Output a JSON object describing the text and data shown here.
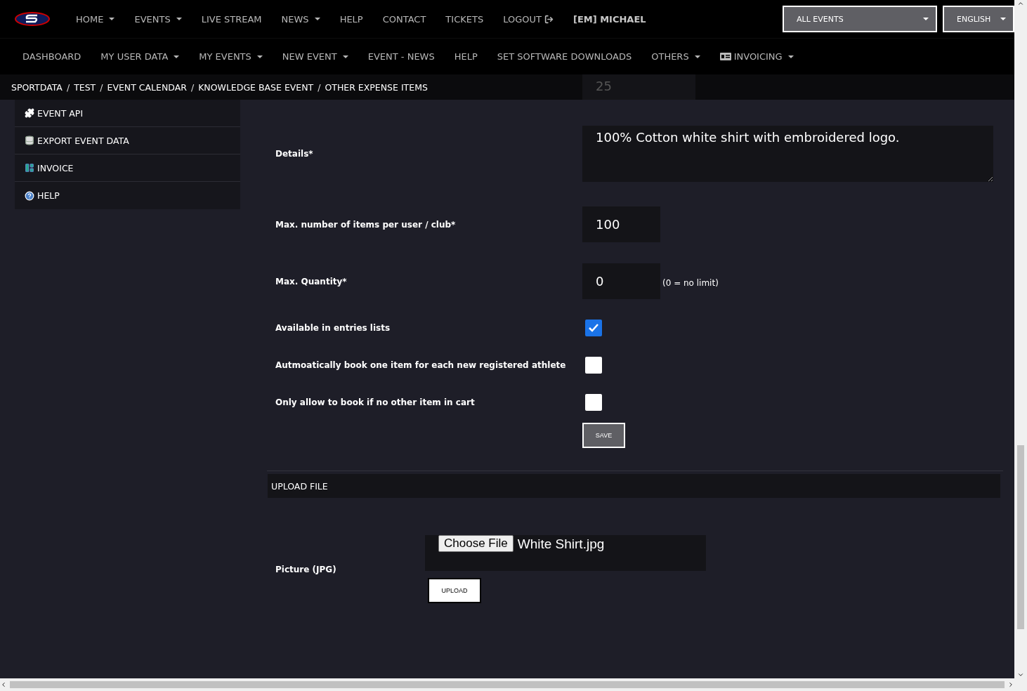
{
  "top_nav": {
    "items": [
      {
        "label": "HOME",
        "dropdown": true,
        "kind": "link"
      },
      {
        "label": "EVENTS",
        "dropdown": true,
        "kind": "link"
      },
      {
        "label": "LIVE STREAM",
        "dropdown": false,
        "kind": "link"
      },
      {
        "label": "NEWS",
        "dropdown": true,
        "kind": "link"
      },
      {
        "label": "HELP",
        "dropdown": false,
        "kind": "link"
      },
      {
        "label": "CONTACT",
        "dropdown": false,
        "kind": "link"
      },
      {
        "label": "TICKETS",
        "dropdown": false,
        "kind": "link"
      },
      {
        "label": "LOGOUT",
        "dropdown": false,
        "kind": "logout"
      },
      {
        "label": "[EM] MICHAEL",
        "dropdown": false,
        "kind": "user"
      }
    ],
    "event_select": "ALL EVENTS",
    "language_select": "ENGLISH"
  },
  "sub_nav": {
    "items": [
      {
        "label": "DASHBOARD",
        "dropdown": false,
        "kind": "link"
      },
      {
        "label": "MY USER DATA",
        "dropdown": true,
        "kind": "link"
      },
      {
        "label": "MY EVENTS",
        "dropdown": true,
        "kind": "link"
      },
      {
        "label": "NEW EVENT",
        "dropdown": true,
        "kind": "link"
      },
      {
        "label": "EVENT - NEWS",
        "dropdown": false,
        "kind": "link"
      },
      {
        "label": "HELP",
        "dropdown": false,
        "kind": "link"
      },
      {
        "label": "SET SOFTWARE DOWNLOADS",
        "dropdown": false,
        "kind": "link"
      },
      {
        "label": "OTHERS",
        "dropdown": true,
        "kind": "link"
      },
      {
        "label": "INVOICING",
        "dropdown": true,
        "kind": "invoicing"
      }
    ]
  },
  "breadcrumb": [
    {
      "label": "SPORTDATA",
      "separator": "/"
    },
    {
      "label": "TEST",
      "separator": "/"
    },
    {
      "label": "EVENT CALENDAR",
      "separator": "/"
    },
    {
      "label": "KNOWLEDGE BASE EVENT",
      "separator": "/"
    },
    {
      "label": "OTHER EXPENSE ITEMS"
    }
  ],
  "hidden_field_value": "25",
  "sidebar": {
    "items": [
      {
        "label": "EVENT API",
        "kind": "puzzle"
      },
      {
        "label": "EXPORT EVENT DATA",
        "kind": "export"
      },
      {
        "label": "INVOICE",
        "kind": "invoice"
      },
      {
        "label": "HELP",
        "kind": "help"
      }
    ]
  },
  "form": {
    "rows": [
      {
        "kind": "textarea",
        "label": "Details*",
        "value": "100% Cotton white shirt with embroidered logo."
      },
      {
        "kind": "number",
        "label": "Max. number of items per user / club*",
        "value": "100"
      },
      {
        "kind": "number",
        "label": "Max. Quantity*",
        "value": "0",
        "hint": "(0 = no limit)"
      },
      {
        "kind": "checkbox",
        "label": "Available in entries lists",
        "checked": true
      },
      {
        "kind": "checkbox",
        "label": "Autmoatically book one item for each new registered athlete",
        "checked": false
      },
      {
        "kind": "checkbox",
        "label": "Only allow to book if no other item in cart",
        "checked": false
      }
    ],
    "save_button": "SAVE"
  },
  "upload": {
    "title": "UPLOAD FILE",
    "label": "Picture (JPG)",
    "choose_button": "Choose File",
    "file_name": "White Shirt.jpg",
    "upload_button": "UPLOAD"
  }
}
